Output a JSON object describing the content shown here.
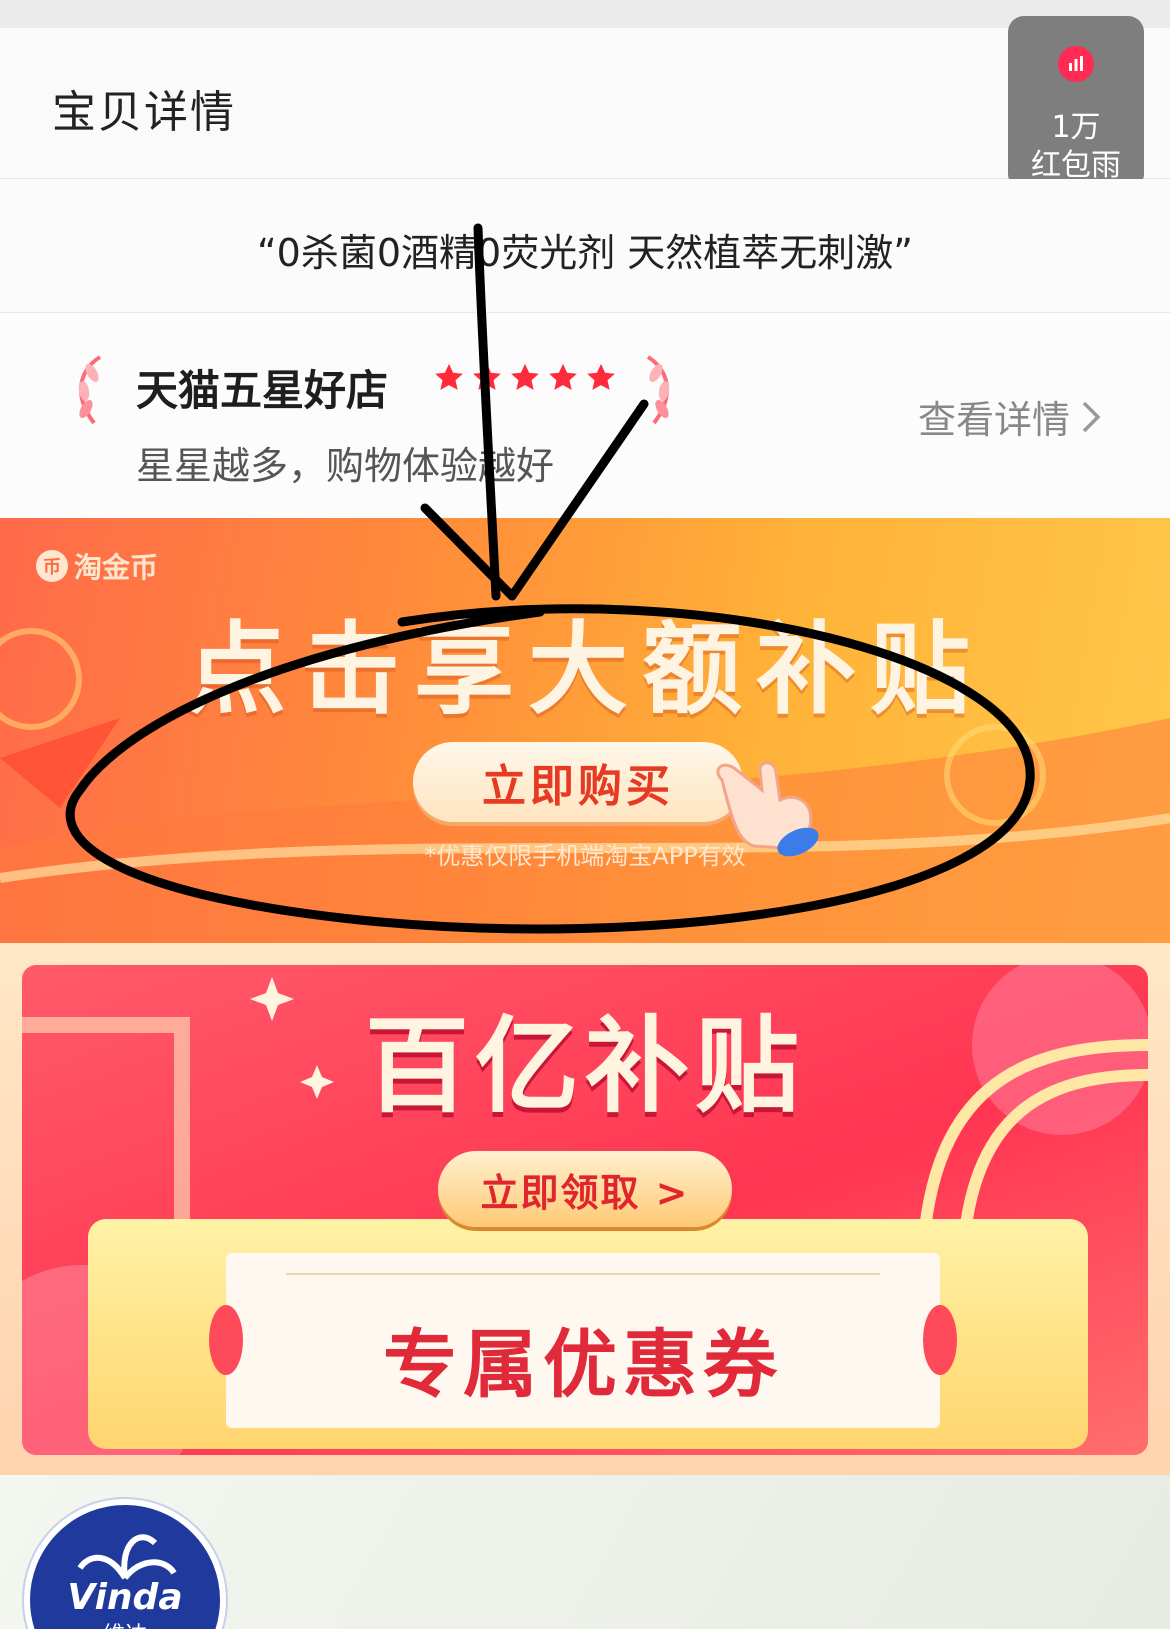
{
  "header": {
    "title": "宝贝详情"
  },
  "red_packet_widget": {
    "icon": "bar-chart-icon",
    "count": "1万",
    "label": "红包雨",
    "accent": "#ff2b54"
  },
  "slogan": "“0杀菌0酒精0荧光剂 天然植萃无刺激”",
  "store": {
    "title": "天猫五星好店",
    "stars": 5,
    "subtitle": "星星越多，购物体验越好",
    "view_detail": "查看详情",
    "star_color": "#ff2a3a"
  },
  "banner_taojinbi": {
    "brand": "淘金币",
    "brand_icon": "币",
    "headline": "点击享大额补贴",
    "button": "立即购买",
    "note": "*优惠仅限手机端淘宝APP有效"
  },
  "banner_subsidy": {
    "headline": "百亿补贴",
    "button": "立即领取 >",
    "coupon": "专属优惠券"
  },
  "brand": {
    "logo_text": "Vinda",
    "logo_cn": "维达"
  }
}
